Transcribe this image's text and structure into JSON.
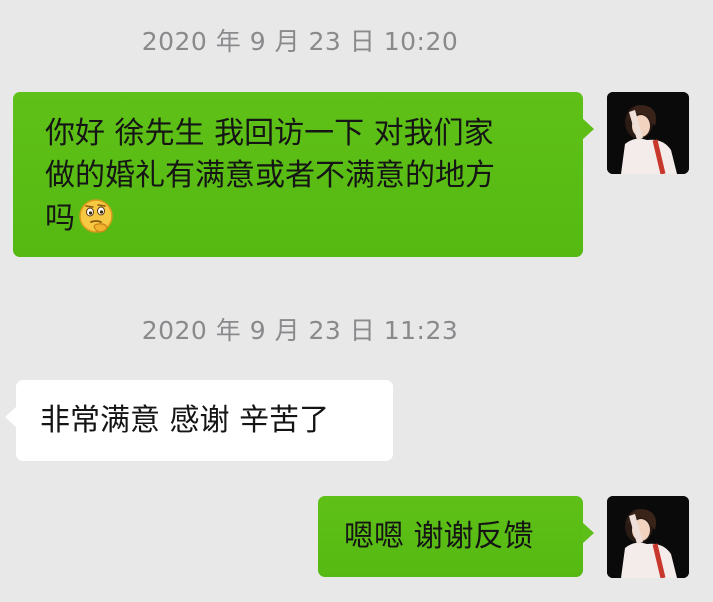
{
  "messages": [
    {
      "timestamp": "2020 年 9 月 23 日 10:20",
      "text_line1": "你好 徐先生 我回访一下 对我们家",
      "text_line2": "做的婚礼有满意或者不满意的地方",
      "text_line3": "吗",
      "sender": "self",
      "emoji": "thinking-face-icon"
    },
    {
      "timestamp": "2020 年 9 月 23 日 11:23",
      "text": "非常满意 感谢 辛苦了",
      "sender": "other"
    },
    {
      "text": "嗯嗯 谢谢反馈",
      "sender": "self"
    }
  ],
  "colors": {
    "background": "#e8e8e9",
    "self_bubble": "#5cbe16",
    "other_bubble": "#ffffff",
    "timestamp_text": "#8a8a8d"
  }
}
